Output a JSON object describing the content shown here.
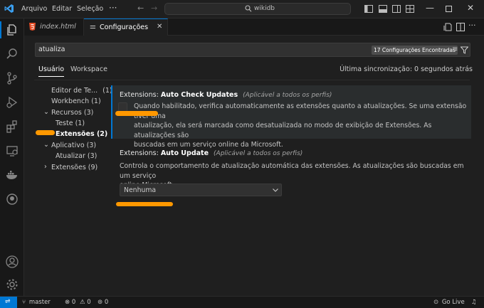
{
  "titlebar": {
    "menu": [
      "Arquivo",
      "Editar",
      "Seleção"
    ],
    "more_icon": "ellipsis-icon",
    "search_text": "wikidb"
  },
  "tabs": [
    {
      "label": "index.html",
      "icon": "html-file-icon"
    },
    {
      "label": "Configurações",
      "icon": "settings-icon"
    }
  ],
  "settings": {
    "search_value": "atualiza",
    "found_badge": "17 Configurações Encontradas",
    "scopes": [
      "Usuário",
      "Workspace"
    ],
    "sync_status": "Última sincronização: 0 segundos atrás",
    "toc": [
      {
        "label": "Editor de Te...",
        "count": "(1)"
      },
      {
        "label": "Workbench (1)"
      },
      {
        "label": "Recursos (3)"
      },
      {
        "label": "Teste (1)"
      },
      {
        "label": "Extensões (2)"
      },
      {
        "label": "Aplicativo (3)"
      },
      {
        "label": "Atualizar (3)"
      },
      {
        "label": "Extensões (9)"
      }
    ],
    "items": [
      {
        "category": "Extensions: ",
        "name": "Auto Check Updates",
        "scope_note": "(Aplicável a todos os perfis)",
        "desc_lines": [
          "Quando habilitado, verifica automaticamente as extensões quanto a atualizações. Se uma extensão tiver uma",
          "atualização, ela será marcada como desatualizada no modo de exibição de Extensões. As atualizações são",
          "buscadas em um serviço online da Microsoft."
        ]
      },
      {
        "category": "Extensions: ",
        "name": "Auto Update",
        "scope_note": "(Aplicável a todos os perfis)",
        "desc_lines": [
          "Controla o comportamento de atualização automática das extensões. As atualizações são buscadas em um serviço",
          "online Microsoft."
        ],
        "select_value": "Nenhuma"
      }
    ]
  },
  "statusbar": {
    "branch": "master",
    "errors": "0",
    "warnings": "0",
    "ports": "0",
    "go_live": "Go Live"
  },
  "colors": {
    "accent": "#0078d4",
    "highlight": "#ff9800"
  }
}
